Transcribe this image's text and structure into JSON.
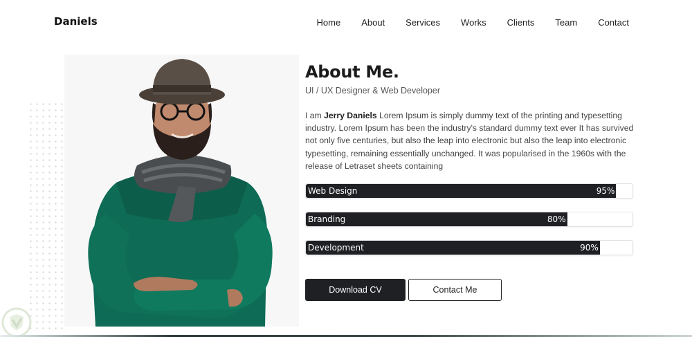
{
  "brand": "Daniels",
  "nav": {
    "items": [
      "Home",
      "About",
      "Services",
      "Works",
      "Clients",
      "Team",
      "Contact"
    ]
  },
  "about": {
    "title": "About Me.",
    "subtitle": "UI / UX Designer & Web Developer",
    "bio_prefix": "I am ",
    "bio_name": "Jerry Daniels",
    "bio_text": " Lorem Ipsum is simply dummy text of the printing and typesetting industry. Lorem Ipsum has been the industry's standard dummy text ever It has survived not only five centuries, but also the leap into electronic but also the leap into electronic typesetting, remaining essentially unchanged. It was popularised in the 1960s with the release of Letraset sheets containing"
  },
  "skills": [
    {
      "name": "Web Design",
      "percent": 95,
      "label": "95%"
    },
    {
      "name": "Branding",
      "percent": 80,
      "label": "80%"
    },
    {
      "name": "Development",
      "percent": 90,
      "label": "90%"
    }
  ],
  "buttons": {
    "download": "Download CV",
    "contact": "Contact Me"
  },
  "colors": {
    "dark": "#1f2023",
    "sweater": "#0e6b55",
    "accent_bg": "#f7f7f7"
  },
  "icons": {
    "portrait": "man-with-hat-photo",
    "watermark": "shield-watermark-icon"
  }
}
